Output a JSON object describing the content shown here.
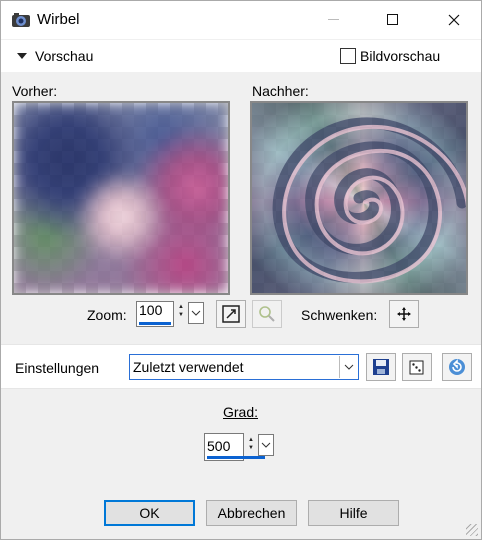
{
  "window": {
    "title": "Wirbel"
  },
  "preview_section": {
    "title": "Vorschau",
    "checkbox_label": "Bildvorschau",
    "checkbox_checked": false
  },
  "before_label": "Vorher:",
  "after_label": "Nachher:",
  "zoom": {
    "label": "Zoom:",
    "value": "100",
    "pan_label": "Schwenken:"
  },
  "settings": {
    "label": "Einstellungen",
    "preset": "Zuletzt verwendet"
  },
  "grad": {
    "label": "Grad:",
    "value": "500"
  },
  "buttons": {
    "ok": "OK",
    "cancel": "Abbrechen",
    "help": "Hilfe"
  },
  "colors": {
    "accent": "#0078d7",
    "value_bar": "#0b62d1"
  }
}
